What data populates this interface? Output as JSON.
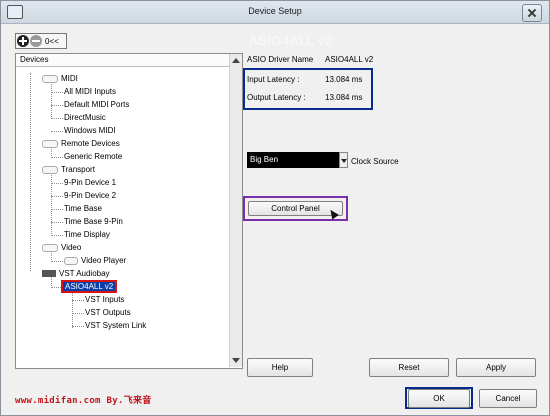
{
  "window": {
    "title": "Device Setup"
  },
  "toolbar": {
    "add_icon": "plus-circle-icon",
    "remove_icon": "minus-circle-icon",
    "collapse_label": "0<<"
  },
  "devices": {
    "header": "Devices",
    "tree": [
      {
        "label": "MIDI",
        "icon": "plug-icon"
      },
      {
        "label": "All MIDI Inputs"
      },
      {
        "label": "Default MIDI Ports"
      },
      {
        "label": "DirectMusic"
      },
      {
        "label": "Windows MIDI"
      },
      {
        "label": "Remote Devices",
        "icon": "plug-icon"
      },
      {
        "label": "Generic Remote"
      },
      {
        "label": "Transport",
        "icon": "plug-icon"
      },
      {
        "label": "9-Pin Device 1"
      },
      {
        "label": "9-Pin Device 2"
      },
      {
        "label": "Time Base"
      },
      {
        "label": "Time Base 9-Pin"
      },
      {
        "label": "Time Display"
      },
      {
        "label": "Video",
        "icon": "plug-icon"
      },
      {
        "label": "Video Player",
        "icon": "video-icon"
      },
      {
        "label": "VST Audiobay",
        "icon": "vst-icon"
      },
      {
        "label": "ASIO4ALL v2",
        "selected": true
      },
      {
        "label": "VST Inputs"
      },
      {
        "label": "VST Outputs"
      },
      {
        "label": "VST System Link"
      }
    ]
  },
  "driver": {
    "title": "ASIO4ALL v2",
    "name_label": "ASIO Driver Name",
    "name_value": "ASIO4ALL v2",
    "input_latency_label": "Input Latency :",
    "input_latency_value": "13.084 ms",
    "output_latency_label": "Output Latency :",
    "output_latency_value": "13.084 ms",
    "clock_source_value": "Big Ben",
    "clock_source_label": "Clock Source",
    "control_panel_label": "Control Panel"
  },
  "buttons": {
    "help": "Help",
    "reset": "Reset",
    "apply": "Apply",
    "ok": "OK",
    "cancel": "Cancel"
  },
  "footer": {
    "watermark": "www.midifan.com  By.飞来音"
  },
  "colors": {
    "selection_bg": "#0b3ea6",
    "highlight_red": "#d61414",
    "highlight_blue": "#0a2a8c",
    "highlight_purple": "#7a2ea8",
    "watermark": "#c1141e"
  }
}
